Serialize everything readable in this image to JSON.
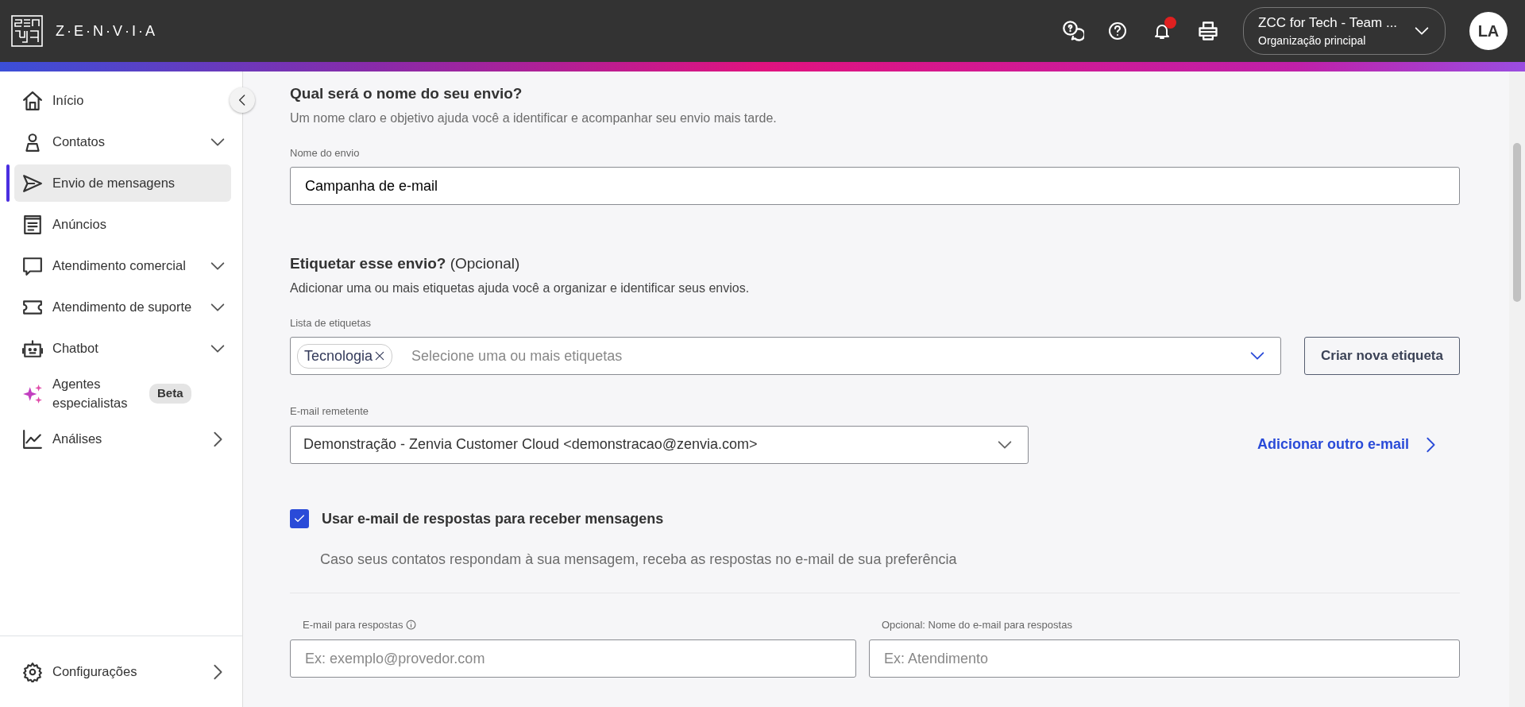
{
  "header": {
    "logo_text": "Z·E·N·V·I·A",
    "notifications": {
      "unread": true
    },
    "org": {
      "name": "ZCC for Tech - Team ...",
      "subtitle": "Organização principal"
    },
    "avatar": "LA"
  },
  "sidebar": {
    "items": [
      {
        "label": "Início",
        "selected": false
      },
      {
        "label": "Contatos",
        "selected": false,
        "expanded": false
      },
      {
        "label": "Envio de mensagens",
        "selected": true
      },
      {
        "label": "Anúncios",
        "selected": false
      },
      {
        "label": "Atendimento comercial",
        "selected": false,
        "expanded": false
      },
      {
        "label": "Atendimento de suporte",
        "selected": false,
        "expanded": false
      },
      {
        "label": "Chatbot",
        "selected": false,
        "expanded": false
      },
      {
        "label": "Agentes especialistas",
        "selected": false,
        "badge": "Beta"
      },
      {
        "label": "Análises",
        "selected": false,
        "submenu": true
      }
    ],
    "footer": {
      "label": "Configurações",
      "submenu": true
    }
  },
  "form": {
    "name_section": {
      "title": "Qual será o nome do seu envio?",
      "subtitle": "Um nome claro e objetivo ajuda você a identificar e acompanhar seu envio mais tarde.",
      "label": "Nome do envio",
      "value": "Campanha de e-mail"
    },
    "tags_section": {
      "title": "Etiquetar esse envio?",
      "title_suffix": "(Opcional)",
      "subtitle": "Adicionar uma ou mais etiquetas ajuda você a organizar e identificar seus envios.",
      "label": "Lista de etiquetas",
      "tags": [
        "Tecnologia"
      ],
      "placeholder": "Selecione uma ou mais etiquetas",
      "button": "Criar nova etiqueta"
    },
    "sender": {
      "label": "E-mail remetente",
      "value": "Demonstração - Zenvia Customer Cloud <demonstracao@zenvia.com>",
      "link": "Adicionar outro e-mail"
    },
    "reply": {
      "checkbox_label": "Usar e-mail de respostas para receber mensagens",
      "checked": true,
      "description": "Caso seus contatos respondam à sua mensagem, receba as respostas no e-mail de sua preferência",
      "fields": [
        {
          "label": "E-mail para respostas",
          "info": true,
          "placeholder": "Ex: exemplo@provedor.com"
        },
        {
          "label": "Opcional: Nome do e-mail para respostas",
          "placeholder": "Ex: Atendimento"
        }
      ]
    }
  }
}
